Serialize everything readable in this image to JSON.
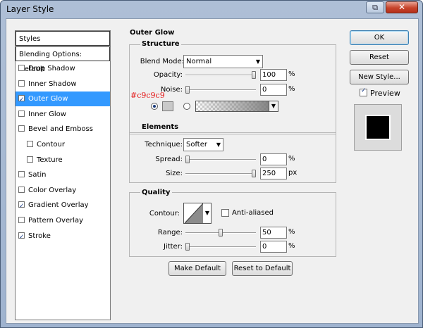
{
  "window": {
    "title": "Layer Style"
  },
  "styles": {
    "header": "Styles",
    "blending": "Blending Options: Default",
    "items": [
      {
        "label": "Drop Shadow",
        "checked": false,
        "selected": false,
        "sub": false
      },
      {
        "label": "Inner Shadow",
        "checked": false,
        "selected": false,
        "sub": false
      },
      {
        "label": "Outer Glow",
        "checked": true,
        "selected": true,
        "sub": false
      },
      {
        "label": "Inner Glow",
        "checked": false,
        "selected": false,
        "sub": false
      },
      {
        "label": "Bevel and Emboss",
        "checked": false,
        "selected": false,
        "sub": false
      },
      {
        "label": "Contour",
        "checked": false,
        "selected": false,
        "sub": true
      },
      {
        "label": "Texture",
        "checked": false,
        "selected": false,
        "sub": true
      },
      {
        "label": "Satin",
        "checked": false,
        "selected": false,
        "sub": false
      },
      {
        "label": "Color Overlay",
        "checked": false,
        "selected": false,
        "sub": false
      },
      {
        "label": "Gradient Overlay",
        "checked": true,
        "selected": false,
        "sub": false
      },
      {
        "label": "Pattern Overlay",
        "checked": false,
        "selected": false,
        "sub": false
      },
      {
        "label": "Stroke",
        "checked": true,
        "selected": false,
        "sub": false
      }
    ]
  },
  "outer_glow": {
    "title": "Outer Glow",
    "structure": {
      "title": "Structure",
      "blend_mode_label": "Blend Mode:",
      "blend_mode_value": "Normal",
      "opacity_label": "Opacity:",
      "opacity_value": "100",
      "opacity_unit": "%",
      "opacity_level": 1.0,
      "noise_label": "Noise:",
      "noise_value": "0",
      "noise_unit": "%",
      "noise_level": 0.0,
      "color_annotation": "#c9c9c9",
      "glow_color": "#c9c9c9"
    },
    "elements": {
      "title": "Elements",
      "technique_label": "Technique:",
      "technique_value": "Softer",
      "spread_label": "Spread:",
      "spread_value": "0",
      "spread_unit": "%",
      "spread_level": 0.0,
      "size_label": "Size:",
      "size_value": "250",
      "size_unit": "px",
      "size_level": 1.0
    },
    "quality": {
      "title": "Quality",
      "contour_label": "Contour:",
      "antialiased_label": "Anti-aliased",
      "antialiased_checked": false,
      "range_label": "Range:",
      "range_value": "50",
      "range_unit": "%",
      "range_level": 0.5,
      "jitter_label": "Jitter:",
      "jitter_value": "0",
      "jitter_unit": "%",
      "jitter_level": 0.0
    },
    "make_default": "Make Default",
    "reset_default": "Reset to Default"
  },
  "buttons": {
    "ok": "OK",
    "reset": "Reset",
    "new_style": "New Style...",
    "preview_label": "Preview",
    "preview_checked": true
  }
}
